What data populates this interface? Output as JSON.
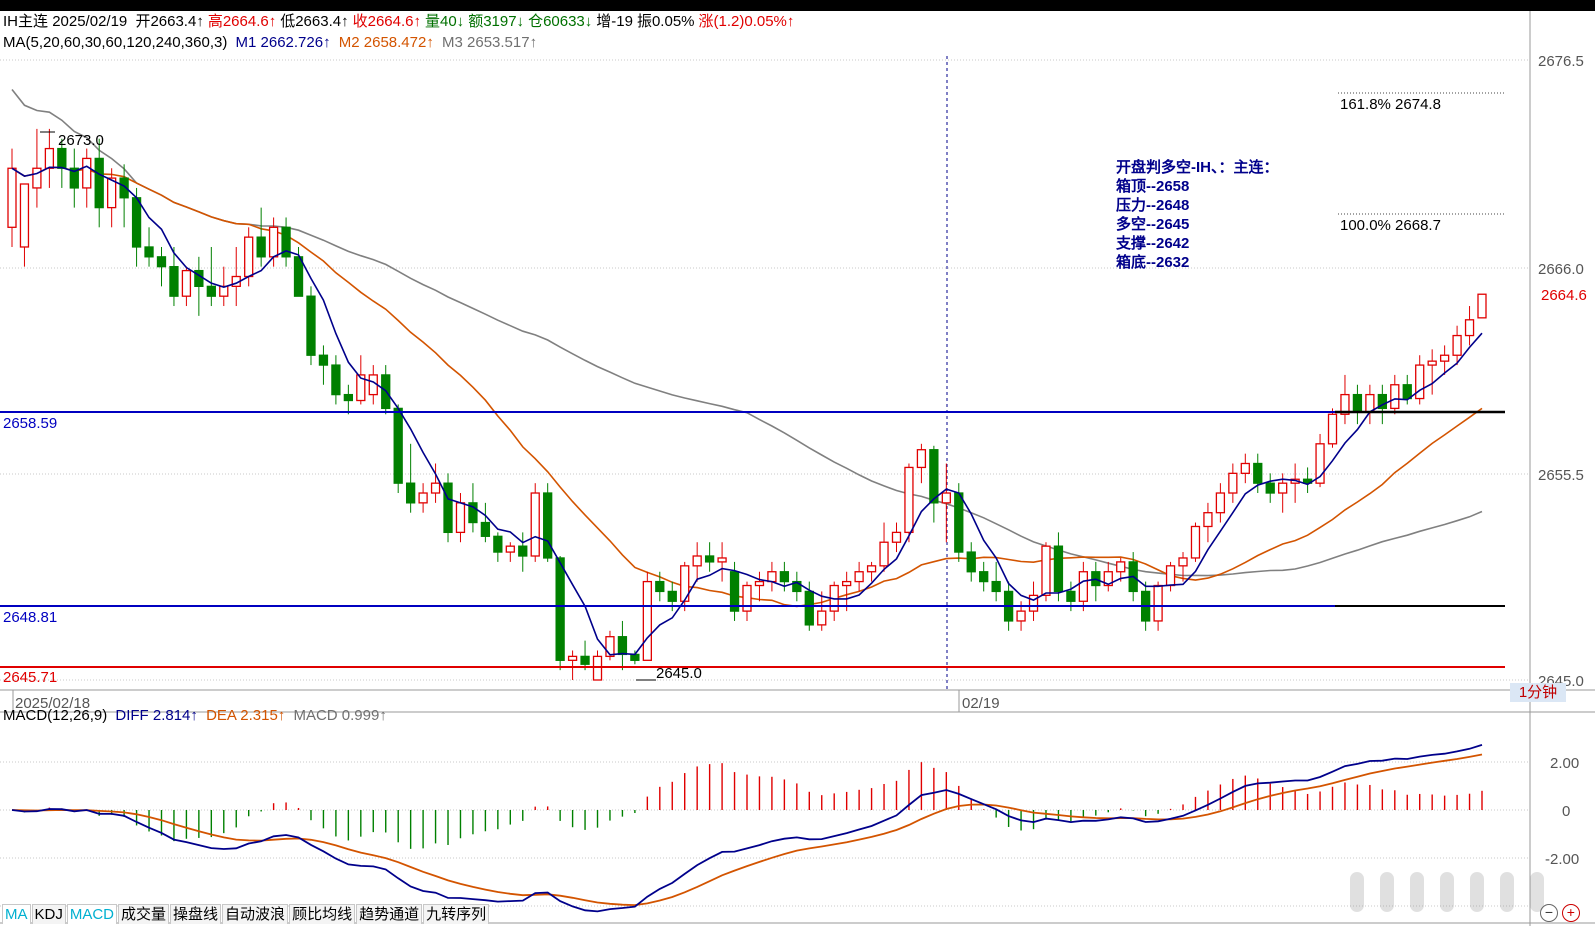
{
  "header": {
    "symbol": "IH主连",
    "date": "2025/02/19",
    "open_label": "开2663.4↑",
    "high_label": "高2664.6↑",
    "low_label": "低2663.4↑",
    "close_label": "收2664.6↑",
    "volume_label": "量40↓",
    "amount_label": "额3197↓",
    "open_interest_label": "仓60633↓",
    "increase_label": "增-19",
    "amplitude_label": "振0.05%",
    "change_label": "涨(1.2)0.05%↑"
  },
  "ma_line": {
    "params": "MA(5,20,60,30,60,120,240,360,3)",
    "m1": "M1 2662.726↑",
    "m2": "M2 2658.472↑",
    "m3": "M3 2653.517↑"
  },
  "price_axis": [
    "2676.5",
    "2666.0",
    "2655.5",
    "2645.0"
  ],
  "current_price": "2664.6",
  "levels": {
    "upper": "2658.59",
    "middle": "2648.81",
    "lower": "2645.71"
  },
  "annotations": {
    "high_mark": "2673.0",
    "low_mark": "2645.0",
    "fib_1618": "161.8% 2674.8",
    "fib_100": "100.0% 2668.7"
  },
  "note": {
    "title": "开盘判多空-IH、：主连：",
    "lines": [
      "箱顶--2658",
      "压力--2648",
      "多空--2645",
      "支撑--2642",
      "箱底--2632"
    ]
  },
  "time_axis": {
    "left_date": "2025/02/18",
    "mid_date": "02/19",
    "unit": "1分钟"
  },
  "macd": {
    "params": "MACD(12,26,9)",
    "diff": "DIFF 2.814↑",
    "dea": "DEA 2.315↑",
    "macd": "MACD 0.999↑",
    "axis": [
      "2.00",
      "0",
      "-2.00"
    ]
  },
  "tabs": [
    "MA",
    "KDJ",
    "MACD",
    "成交量",
    "操盘线",
    "自动波浪",
    "顾比均线",
    "趋势通道",
    "九转序列"
  ],
  "colors": {
    "up": "#e00000",
    "down": "#008000",
    "ma1": "#00008b",
    "ma2": "#d35400",
    "ma3": "#808080",
    "level_line": "#0000c0",
    "support_line": "#e00000"
  },
  "chart_data": {
    "type": "candlestick",
    "y_range": [
      2644.5,
      2677.5
    ],
    "candles": [
      {
        "o": 2668,
        "h": 2672,
        "l": 2667,
        "c": 2671
      },
      {
        "o": 2667,
        "h": 2670,
        "l": 2666,
        "c": 2670.2
      },
      {
        "o": 2670,
        "h": 2673,
        "l": 2669,
        "c": 2671
      },
      {
        "o": 2671,
        "h": 2673,
        "l": 2670,
        "c": 2672
      },
      {
        "o": 2672,
        "h": 2672.5,
        "l": 2670,
        "c": 2671
      },
      {
        "o": 2671,
        "h": 2672,
        "l": 2669,
        "c": 2670
      },
      {
        "o": 2670,
        "h": 2672,
        "l": 2669,
        "c": 2671.5
      },
      {
        "o": 2671.5,
        "h": 2672.5,
        "l": 2668,
        "c": 2669
      },
      {
        "o": 2669,
        "h": 2671,
        "l": 2668,
        "c": 2670.5
      },
      {
        "o": 2670.5,
        "h": 2671.2,
        "l": 2668,
        "c": 2669.5
      },
      {
        "o": 2669.5,
        "h": 2670,
        "l": 2666,
        "c": 2667
      },
      {
        "o": 2667,
        "h": 2668,
        "l": 2666,
        "c": 2666.5
      },
      {
        "o": 2666.5,
        "h": 2667,
        "l": 2665,
        "c": 2666
      },
      {
        "o": 2666,
        "h": 2667,
        "l": 2664,
        "c": 2664.5
      },
      {
        "o": 2664.5,
        "h": 2666,
        "l": 2664,
        "c": 2665.8
      },
      {
        "o": 2665.8,
        "h": 2666.5,
        "l": 2663.5,
        "c": 2665
      },
      {
        "o": 2665,
        "h": 2667,
        "l": 2664,
        "c": 2664.5
      },
      {
        "o": 2664.5,
        "h": 2666,
        "l": 2664,
        "c": 2665
      },
      {
        "o": 2665,
        "h": 2667,
        "l": 2664,
        "c": 2665.5
      },
      {
        "o": 2665.5,
        "h": 2668,
        "l": 2665,
        "c": 2667.5
      },
      {
        "o": 2667.5,
        "h": 2669,
        "l": 2666,
        "c": 2666.5
      },
      {
        "o": 2666.5,
        "h": 2668.5,
        "l": 2666,
        "c": 2668
      },
      {
        "o": 2668,
        "h": 2668.5,
        "l": 2666,
        "c": 2666.5
      },
      {
        "o": 2666.5,
        "h": 2667,
        "l": 2665,
        "c": 2664.5
      },
      {
        "o": 2664.5,
        "h": 2665,
        "l": 2661,
        "c": 2661.5
      },
      {
        "o": 2661.5,
        "h": 2662,
        "l": 2660,
        "c": 2661
      },
      {
        "o": 2661,
        "h": 2661.5,
        "l": 2659,
        "c": 2659.5
      },
      {
        "o": 2659.5,
        "h": 2660,
        "l": 2658.5,
        "c": 2659.2
      },
      {
        "o": 2659.2,
        "h": 2661.5,
        "l": 2659,
        "c": 2660.5
      },
      {
        "o": 2659.5,
        "h": 2661,
        "l": 2659,
        "c": 2660.5
      },
      {
        "o": 2660.5,
        "h": 2661,
        "l": 2658.5,
        "c": 2658.8
      },
      {
        "o": 2658.8,
        "h": 2659,
        "l": 2654.5,
        "c": 2655
      },
      {
        "o": 2655,
        "h": 2657,
        "l": 2653.5,
        "c": 2654
      },
      {
        "o": 2654,
        "h": 2655,
        "l": 2653.5,
        "c": 2654.5
      },
      {
        "o": 2654.5,
        "h": 2656,
        "l": 2654,
        "c": 2655
      },
      {
        "o": 2655,
        "h": 2655.5,
        "l": 2652,
        "c": 2652.5
      },
      {
        "o": 2652.5,
        "h": 2654.5,
        "l": 2652,
        "c": 2654
      },
      {
        "o": 2654,
        "h": 2655,
        "l": 2652.5,
        "c": 2653
      },
      {
        "o": 2653,
        "h": 2654,
        "l": 2652,
        "c": 2652.3
      },
      {
        "o": 2652.3,
        "h": 2652.5,
        "l": 2651,
        "c": 2651.5
      },
      {
        "o": 2651.5,
        "h": 2652,
        "l": 2651,
        "c": 2651.8
      },
      {
        "o": 2651.8,
        "h": 2652.5,
        "l": 2650.5,
        "c": 2651.3
      },
      {
        "o": 2651.3,
        "h": 2655,
        "l": 2651,
        "c": 2654.5
      },
      {
        "o": 2654.5,
        "h": 2655,
        "l": 2651,
        "c": 2651.2
      },
      {
        "o": 2651.2,
        "h": 2651.3,
        "l": 2645.5,
        "c": 2646
      },
      {
        "o": 2646,
        "h": 2646.5,
        "l": 2645,
        "c": 2646.2
      },
      {
        "o": 2646.2,
        "h": 2647,
        "l": 2645.5,
        "c": 2645.8
      },
      {
        "o": 2645,
        "h": 2646.5,
        "l": 2645,
        "c": 2646.2
      },
      {
        "o": 2646.2,
        "h": 2647.5,
        "l": 2646,
        "c": 2647.2
      },
      {
        "o": 2647.2,
        "h": 2648,
        "l": 2645.5,
        "c": 2646.3
      },
      {
        "o": 2646.3,
        "h": 2646.5,
        "l": 2645.8,
        "c": 2646
      },
      {
        "o": 2646,
        "h": 2650.5,
        "l": 2646,
        "c": 2650
      },
      {
        "o": 2650,
        "h": 2650.5,
        "l": 2649,
        "c": 2649.5
      },
      {
        "o": 2649.5,
        "h": 2650,
        "l": 2648.5,
        "c": 2649
      },
      {
        "o": 2649,
        "h": 2651,
        "l": 2648.5,
        "c": 2650.8
      },
      {
        "o": 2650.8,
        "h": 2652,
        "l": 2650,
        "c": 2651.3
      },
      {
        "o": 2651.3,
        "h": 2652,
        "l": 2650.5,
        "c": 2651
      },
      {
        "o": 2651,
        "h": 2652,
        "l": 2650,
        "c": 2651.2
      },
      {
        "o": 2650.5,
        "h": 2651,
        "l": 2648,
        "c": 2648.5
      },
      {
        "o": 2648.5,
        "h": 2650,
        "l": 2648,
        "c": 2649.8
      },
      {
        "o": 2649.8,
        "h": 2650.5,
        "l": 2649,
        "c": 2650
      },
      {
        "o": 2650,
        "h": 2651,
        "l": 2649.5,
        "c": 2650.5
      },
      {
        "o": 2650.5,
        "h": 2651,
        "l": 2649.5,
        "c": 2650
      },
      {
        "o": 2650,
        "h": 2650.5,
        "l": 2649,
        "c": 2649.5
      },
      {
        "o": 2649.5,
        "h": 2650,
        "l": 2647.5,
        "c": 2647.8
      },
      {
        "o": 2647.8,
        "h": 2649.5,
        "l": 2647.5,
        "c": 2648.5
      },
      {
        "o": 2648.5,
        "h": 2650,
        "l": 2648,
        "c": 2649.8
      },
      {
        "o": 2649.8,
        "h": 2650.5,
        "l": 2648.5,
        "c": 2650
      },
      {
        "o": 2650,
        "h": 2651,
        "l": 2649.5,
        "c": 2650.5
      },
      {
        "o": 2650.5,
        "h": 2651,
        "l": 2650,
        "c": 2650.8
      },
      {
        "o": 2650.8,
        "h": 2653,
        "l": 2650.5,
        "c": 2652
      },
      {
        "o": 2652,
        "h": 2653,
        "l": 2651.5,
        "c": 2652.5
      },
      {
        "o": 2652.5,
        "h": 2656,
        "l": 2652,
        "c": 2655.8
      },
      {
        "o": 2655.8,
        "h": 2657,
        "l": 2655,
        "c": 2656.7
      },
      {
        "o": 2656.7,
        "h": 2656.9,
        "l": 2653,
        "c": 2654
      },
      {
        "o": 2654,
        "h": 2656,
        "l": 2652,
        "c": 2654.5
      },
      {
        "o": 2654.5,
        "h": 2655,
        "l": 2651,
        "c": 2651.5
      },
      {
        "o": 2651.5,
        "h": 2652,
        "l": 2650,
        "c": 2650.5
      },
      {
        "o": 2650.5,
        "h": 2651,
        "l": 2649.5,
        "c": 2650
      },
      {
        "o": 2650,
        "h": 2651,
        "l": 2649,
        "c": 2649.5
      },
      {
        "o": 2649.5,
        "h": 2650,
        "l": 2647.5,
        "c": 2648
      },
      {
        "o": 2648,
        "h": 2649,
        "l": 2647.5,
        "c": 2648.5
      },
      {
        "o": 2648.5,
        "h": 2650,
        "l": 2648,
        "c": 2649.3
      },
      {
        "o": 2649.3,
        "h": 2652,
        "l": 2649,
        "c": 2651.8
      },
      {
        "o": 2651.8,
        "h": 2652.5,
        "l": 2649,
        "c": 2649.5
      },
      {
        "o": 2649.5,
        "h": 2650,
        "l": 2648.5,
        "c": 2649
      },
      {
        "o": 2649,
        "h": 2651,
        "l": 2648.5,
        "c": 2650.5
      },
      {
        "o": 2650.5,
        "h": 2651,
        "l": 2649,
        "c": 2649.8
      },
      {
        "o": 2649.8,
        "h": 2651,
        "l": 2649.5,
        "c": 2650.5
      },
      {
        "o": 2650.5,
        "h": 2651.2,
        "l": 2650,
        "c": 2651
      },
      {
        "o": 2651,
        "h": 2651.5,
        "l": 2649,
        "c": 2649.5
      },
      {
        "o": 2649.5,
        "h": 2650,
        "l": 2647.5,
        "c": 2648
      },
      {
        "o": 2648,
        "h": 2650,
        "l": 2647.5,
        "c": 2649.8
      },
      {
        "o": 2649.8,
        "h": 2651,
        "l": 2649.5,
        "c": 2650.8
      },
      {
        "o": 2650.8,
        "h": 2651.5,
        "l": 2650,
        "c": 2651.2
      },
      {
        "o": 2651.2,
        "h": 2653,
        "l": 2651,
        "c": 2652.8
      },
      {
        "o": 2652.8,
        "h": 2654,
        "l": 2652,
        "c": 2653.5
      },
      {
        "o": 2653.5,
        "h": 2655,
        "l": 2653,
        "c": 2654.5
      },
      {
        "o": 2654.5,
        "h": 2656,
        "l": 2654,
        "c": 2655.5
      },
      {
        "o": 2655.5,
        "h": 2656.5,
        "l": 2655,
        "c": 2656
      },
      {
        "o": 2656,
        "h": 2656.5,
        "l": 2654.5,
        "c": 2655
      },
      {
        "o": 2655,
        "h": 2655.5,
        "l": 2654,
        "c": 2654.5
      },
      {
        "o": 2654.5,
        "h": 2655.5,
        "l": 2653.5,
        "c": 2655
      },
      {
        "o": 2655,
        "h": 2656,
        "l": 2654,
        "c": 2655.2
      },
      {
        "o": 2655.2,
        "h": 2655.8,
        "l": 2654.5,
        "c": 2655
      },
      {
        "o": 2655,
        "h": 2657.5,
        "l": 2654.8,
        "c": 2657
      },
      {
        "o": 2657,
        "h": 2658.8,
        "l": 2656.8,
        "c": 2658.5
      },
      {
        "o": 2658.5,
        "h": 2660.5,
        "l": 2658,
        "c": 2659.5
      },
      {
        "o": 2659.5,
        "h": 2660,
        "l": 2658,
        "c": 2658.6
      },
      {
        "o": 2658.6,
        "h": 2660,
        "l": 2658,
        "c": 2659.5
      },
      {
        "o": 2659.5,
        "h": 2660,
        "l": 2658,
        "c": 2658.8
      },
      {
        "o": 2658.8,
        "h": 2660.5,
        "l": 2658.5,
        "c": 2660
      },
      {
        "o": 2660,
        "h": 2660.5,
        "l": 2659,
        "c": 2659.3
      },
      {
        "o": 2659.3,
        "h": 2661.5,
        "l": 2659,
        "c": 2661
      },
      {
        "o": 2661,
        "h": 2661.8,
        "l": 2659.5,
        "c": 2661.2
      },
      {
        "o": 2661.2,
        "h": 2662,
        "l": 2660.5,
        "c": 2661.5
      },
      {
        "o": 2661.5,
        "h": 2663,
        "l": 2661,
        "c": 2662.5
      },
      {
        "o": 2662.5,
        "h": 2664,
        "l": 2662,
        "c": 2663.3
      },
      {
        "o": 2663.4,
        "h": 2664.6,
        "l": 2663.4,
        "c": 2664.6
      }
    ]
  }
}
